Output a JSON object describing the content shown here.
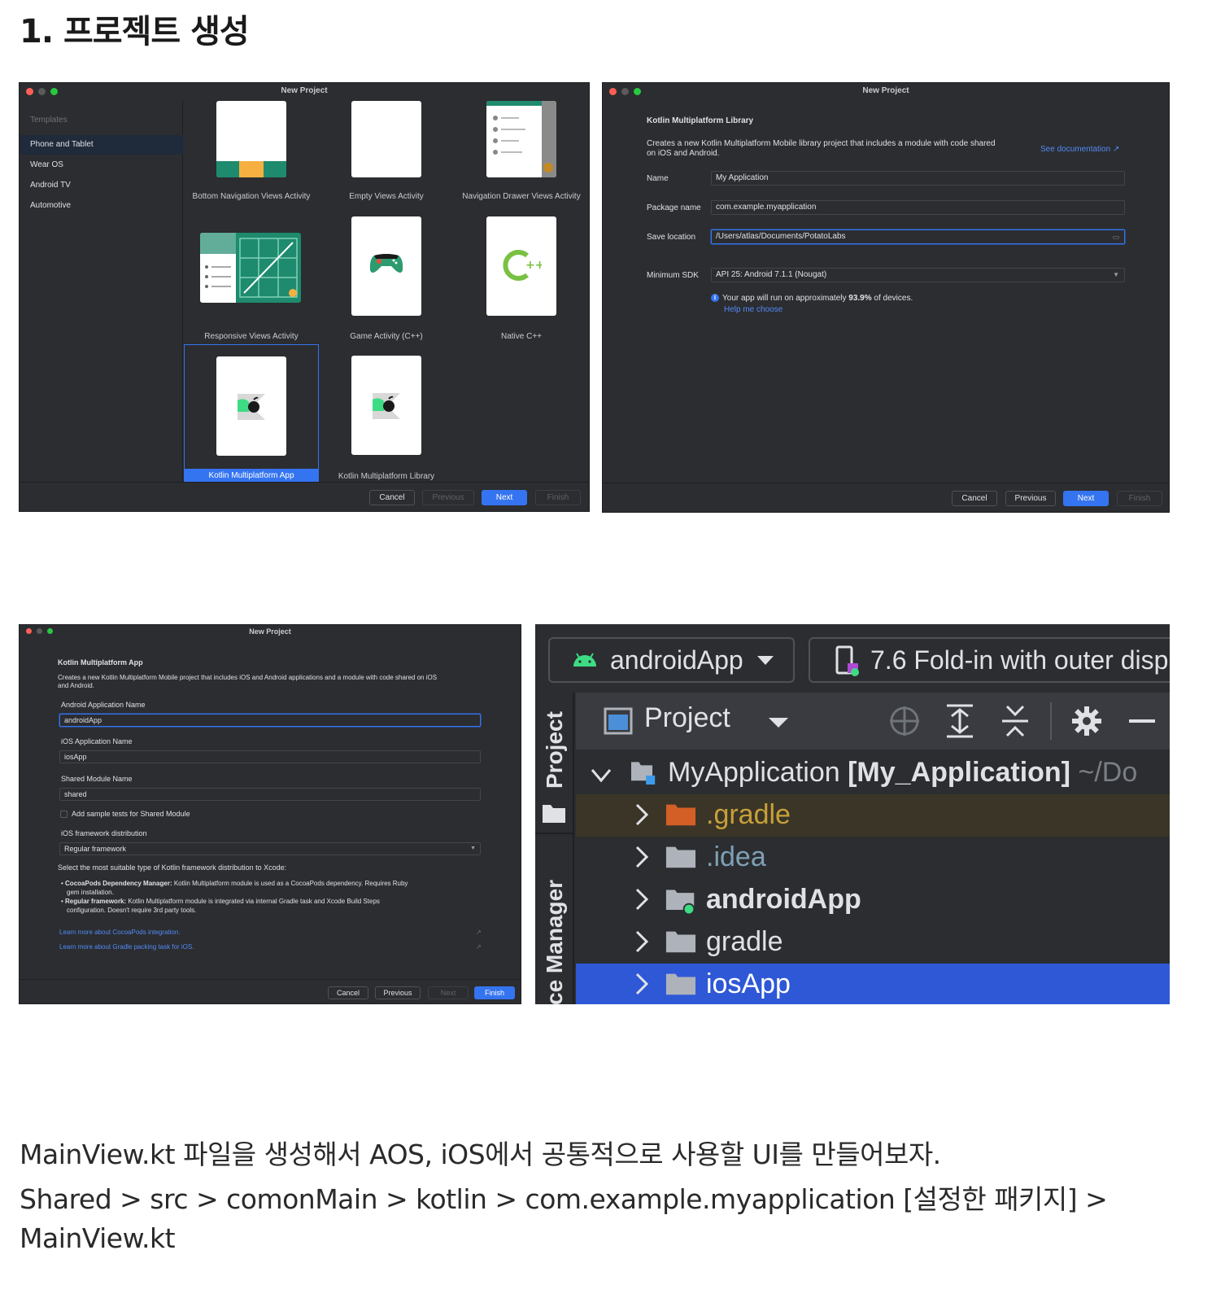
{
  "heading": "1. 프로젝트 생성",
  "dialog_templates": {
    "title": "New Project",
    "sidebar_header": "Templates",
    "sidebar_items": [
      "Phone and Tablet",
      "Wear OS",
      "Android TV",
      "Automotive"
    ],
    "templates": [
      "Bottom Navigation Views Activity",
      "Empty Views Activity",
      "Navigation Drawer Views Activity",
      "Responsive Views Activity",
      "Game Activity (C++)",
      "Native C++",
      "Kotlin Multiplatform App",
      "Kotlin Multiplatform Library"
    ],
    "selected_template": "Kotlin Multiplatform App",
    "buttons": {
      "cancel": "Cancel",
      "previous": "Previous",
      "next": "Next",
      "finish": "Finish"
    }
  },
  "dialog_library": {
    "title": "New Project",
    "heading": "Kotlin Multiplatform Library",
    "description_line1": "Creates a new Kotlin Multiplatform Mobile library project that includes a module with code shared",
    "description_line2": "on iOS and Android.",
    "doc_link": "See documentation ↗",
    "name_label": "Name",
    "name_value": "My Application",
    "package_label": "Package name",
    "package_value": "com.example.myapplication",
    "save_label": "Save location",
    "save_value": "/Users/atlas/Documents/PotatoLabs",
    "sdk_label": "Minimum SDK",
    "sdk_value": "API 25: Android 7.1.1 (Nougat)",
    "info_prefix": "Your app will run on approximately ",
    "info_percent": "93.9%",
    "info_suffix": " of devices.",
    "help_link": "Help me choose",
    "buttons": {
      "cancel": "Cancel",
      "previous": "Previous",
      "next": "Next",
      "finish": "Finish"
    }
  },
  "dialog_app": {
    "title": "New Project",
    "heading": "Kotlin Multiplatform App",
    "description_line1": "Creates a new Kotlin Multiplatform Mobile project that includes iOS and Android applications and a module with code shared on iOS",
    "description_line2": "and Android.",
    "android_name_label": "Android Application Name",
    "android_name_value": "androidApp",
    "ios_name_label": "iOS Application Name",
    "ios_name_value": "iosApp",
    "shared_label": "Shared Module Name",
    "shared_value": "shared",
    "sample_tests_label": "Add sample tests for Shared Module",
    "framework_label": "iOS framework distribution",
    "framework_value": "Regular framework",
    "select_hint": "Select the most suitable type of Kotlin framework distribution to Xcode:",
    "bullet1_bold": "CocoaPods Dependency Manager:",
    "bullet1_text": " Kotlin Multiplatform module is used as a CocoaPods dependency. Requires Ruby",
    "bullet1_cont": "gem installation.",
    "bullet2_bold": "Regular framework:",
    "bullet2_text": " Kotlin Multiplatform module is integrated via internal Gradle task and Xcode Build Steps",
    "bullet2_cont": "configuration. Doesn't require 3rd party tools.",
    "link1": "Learn more about CocoaPods integration.",
    "link2": "Learn more about Gradle packing task for iOS.",
    "buttons": {
      "cancel": "Cancel",
      "previous": "Previous",
      "next": "Next",
      "finish": "Finish"
    }
  },
  "ide": {
    "run_config": "androidApp",
    "device": "7.6  Fold-in with outer disp",
    "tool_window_label": "Project",
    "stripe_project": "Project",
    "stripe_manager": "ce Manager",
    "root_name": "MyApplication",
    "root_module": "[My_Application]",
    "root_path": "~/Do",
    "tree_items": [
      ".gradle",
      ".idea",
      "androidApp",
      "gradle",
      "iosApp"
    ],
    "colors": {
      "selected_row": "#2f58d6",
      "gradle_row": "#3a3527",
      "gradle_text": "#c7a039",
      "idea_text": "#7fa0b5",
      "android_green": "#3ddc84"
    }
  },
  "paragraph": {
    "line1": "MainView.kt 파일을 생성해서 AOS, iOS에서 공통적으로 사용할 UI를 만들어보자.",
    "line2": "Shared > src > comonMain > kotlin > com.example.myapplication [설정한 패키지] >",
    "line3": "MainView.kt"
  }
}
